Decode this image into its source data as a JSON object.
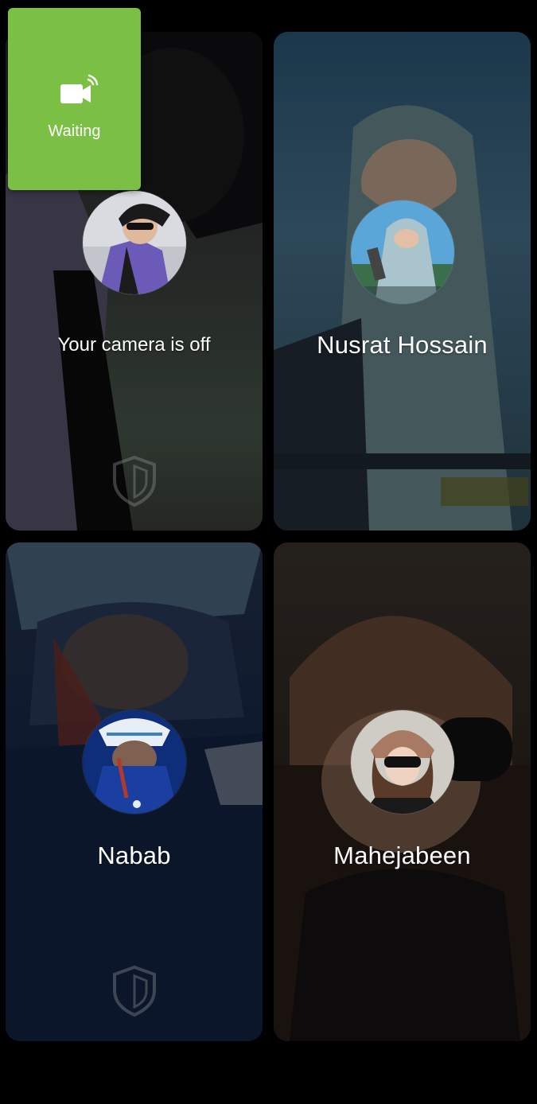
{
  "self_preview": {
    "status_label": "Waiting",
    "icon": "video-camera-wifi-icon",
    "bg_color": "#7bbf45"
  },
  "tiles": [
    {
      "name": "",
      "status": "Your camera is off",
      "shield_icon": "shield-icon"
    },
    {
      "name": "Nusrat Hossain"
    },
    {
      "name": "Nabab",
      "shield_icon": "shield-icon"
    },
    {
      "name": "Mahejabeen"
    }
  ]
}
